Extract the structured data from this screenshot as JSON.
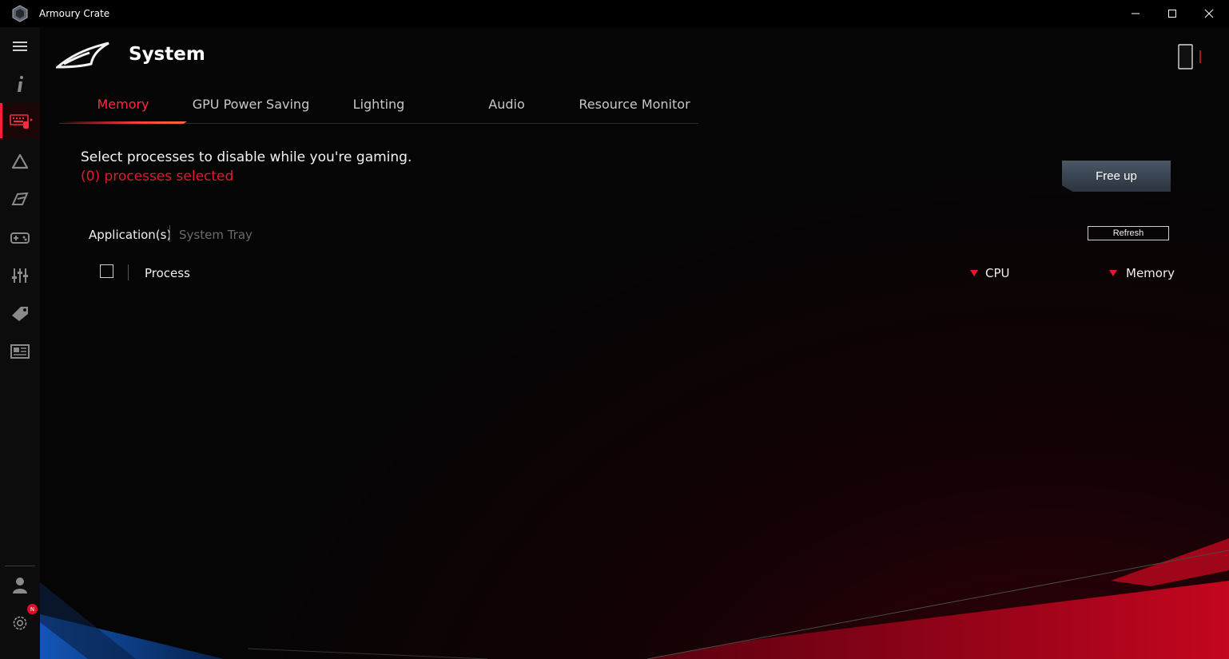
{
  "window": {
    "title": "Armoury Crate",
    "controls": [
      "minimize-icon",
      "maximize-icon",
      "close-icon"
    ]
  },
  "sidebar": {
    "items": [
      {
        "icon": "menu-icon"
      },
      {
        "icon": "info-icon"
      },
      {
        "icon": "keyboard-icon",
        "active": true
      },
      {
        "icon": "aura-triangle-icon"
      },
      {
        "icon": "scenario-icon"
      },
      {
        "icon": "gamepad-icon"
      },
      {
        "icon": "sliders-icon"
      },
      {
        "icon": "tag-icon"
      },
      {
        "icon": "news-icon"
      }
    ],
    "bottom": [
      {
        "icon": "user-icon"
      },
      {
        "icon": "settings-icon",
        "badge": "N"
      }
    ]
  },
  "header": {
    "title": "System"
  },
  "tabs": [
    {
      "label": "Memory",
      "active": true
    },
    {
      "label": "GPU Power Saving"
    },
    {
      "label": "Lighting"
    },
    {
      "label": "Audio"
    },
    {
      "label": "Resource Monitor"
    }
  ],
  "memory": {
    "instruction": "Select processes to disable while you're gaming.",
    "selected_count": "(0) processes selected",
    "free_up_label": "Free up",
    "subtabs": {
      "applications": "Application(s)",
      "system_tray": "System Tray"
    },
    "refresh_label": "Refresh",
    "columns": {
      "process": "Process",
      "cpu": "CPU",
      "memory": "Memory"
    },
    "sort_icon": "sort-down-icon"
  },
  "colors": {
    "accent_red": "#e3192f",
    "background": "#050505",
    "button_gray": "#3a4553"
  }
}
